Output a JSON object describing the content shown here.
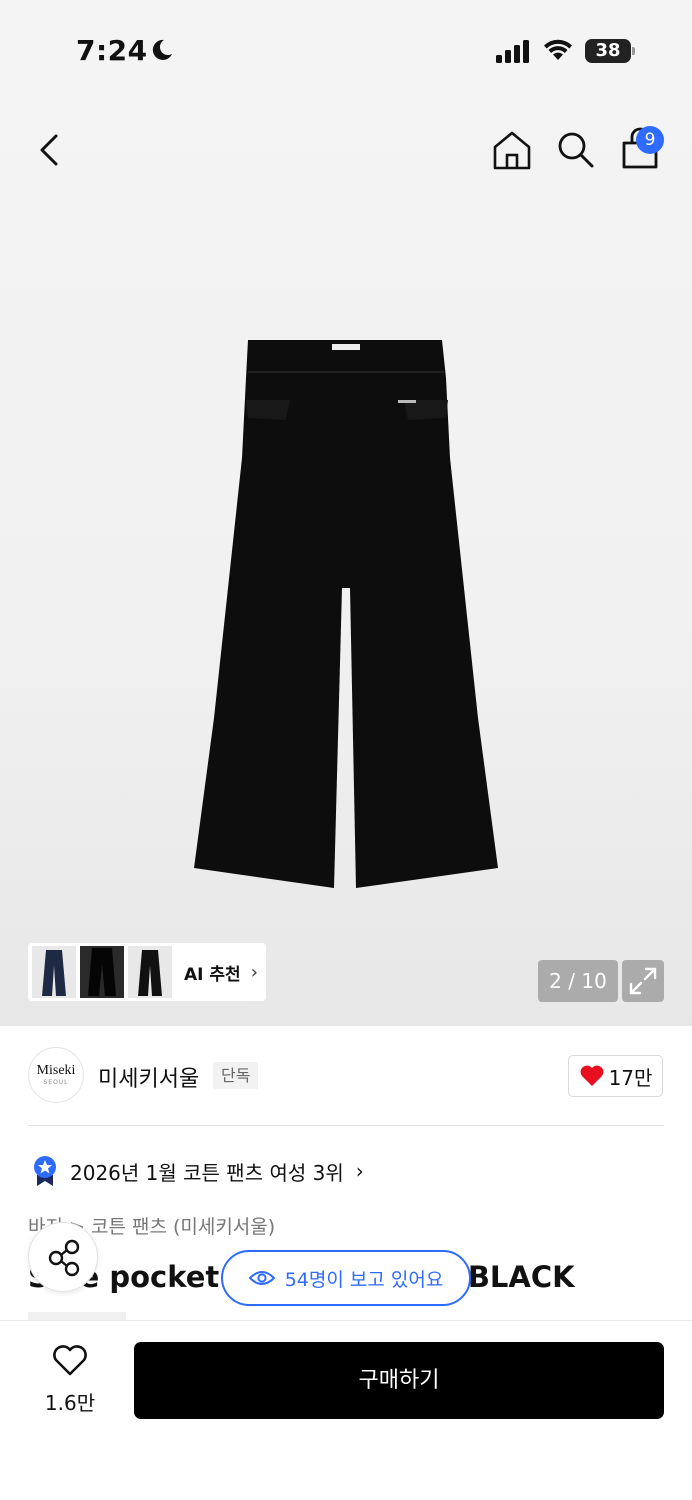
{
  "status_bar": {
    "time": "7:24",
    "battery": "38"
  },
  "nav": {
    "cart_count": "9"
  },
  "gallery": {
    "ai_label": "AI 추천",
    "counter": "2 / 10"
  },
  "brand": {
    "logo_text": "Miseki",
    "logo_sub": "SEOUL",
    "name": "미세키서울",
    "tag": "단독",
    "likes": "17만"
  },
  "ranking": {
    "text": "2026년 1월 코튼 팬츠 여성 3위"
  },
  "breadcrumb": "바지 > 코튼 팬츠 (미세키서울)",
  "product": {
    "title": "Side pocket bootcut pants BLACK"
  },
  "viewers": {
    "text": "54명이 보고 있어요"
  },
  "bottom": {
    "wish_count": "1.6만",
    "buy_label": "구매하기"
  },
  "colors": {
    "accent": "#2f6bff",
    "heart": "#e8101f",
    "buy_bg": "#000000"
  }
}
